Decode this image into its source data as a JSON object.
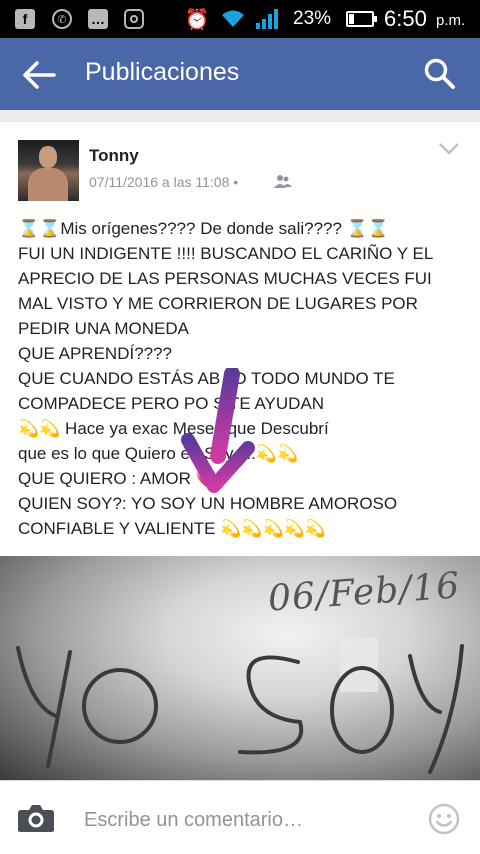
{
  "status_bar": {
    "app_icons": [
      "facebook-icon",
      "whatsapp-icon",
      "messenger-icon",
      "instagram-icon"
    ],
    "battery_percent": "23%",
    "battery_level": 0.23,
    "time": "6:50",
    "ampm": "p.m."
  },
  "header": {
    "title": "Publicaciones",
    "background": "#4a67a7"
  },
  "post": {
    "author": "Tonny",
    "date": "07/11/2016 a las 11:08 •",
    "lines": [
      "⌛⌛Mis orígenes???? De donde sali???? ⌛⌛",
      "FUI UN INDIGENTE !!!! BUSCANDO EL CARIÑO Y EL",
      "APRECIO DE LAS PERSONAS MUCHAS VECES FUI",
      "MAL VISTO Y ME CORRIERON DE LUGARES POR",
      "PEDIR UNA MONEDA",
      "QUE APRENDÍ????",
      "QUE CUANDO ESTÁS AB  JO TODO MUNDO TE",
      "COMPADECE PERO PO   S TE AYUDAN",
      "💫💫 Hace ya exac            Meses que Descubrí",
      "que es lo que Quiero         en Soy.....💫💫",
      "QUE QUIERO : AMOR 💗",
      "QUIEN SOY?: YO SOY UN HOMBRE AMOROSO",
      "CONFIABLE Y VALIENTE 💫💫💫💫💫"
    ]
  },
  "photo": {
    "handwritten_date": "06/Feb/16",
    "handwritten_text": "YO SOY"
  },
  "comment_bar": {
    "placeholder": "Escribe un comentario…"
  }
}
